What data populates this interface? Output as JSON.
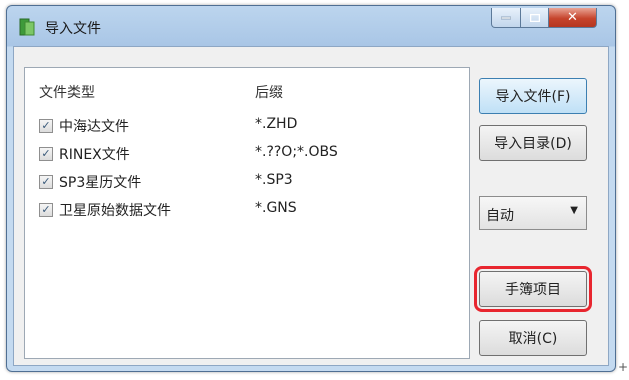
{
  "window": {
    "title": "导入文件",
    "close_glyph": "✕"
  },
  "list": {
    "headers": {
      "type": "文件类型",
      "ext": "后缀"
    },
    "rows": [
      {
        "checked": true,
        "label": "中海达文件",
        "ext": "*.ZHD"
      },
      {
        "checked": true,
        "label": "RINEX文件",
        "ext": "*.??O;*.OBS"
      },
      {
        "checked": true,
        "label": "SP3星历文件",
        "ext": "*.SP3"
      },
      {
        "checked": true,
        "label": "卫星原始数据文件",
        "ext": "*.GNS"
      }
    ]
  },
  "buttons": {
    "import_file": "导入文件(F)",
    "import_dir": "导入目录(D)",
    "manual": "手簿项目",
    "cancel": "取消(C)"
  },
  "mode_select": {
    "value": "自动"
  },
  "check_glyph": "✓",
  "corner_glyph": "+",
  "colors": {
    "highlight": "#e8262f",
    "title_bar": "#a9c6e6"
  }
}
